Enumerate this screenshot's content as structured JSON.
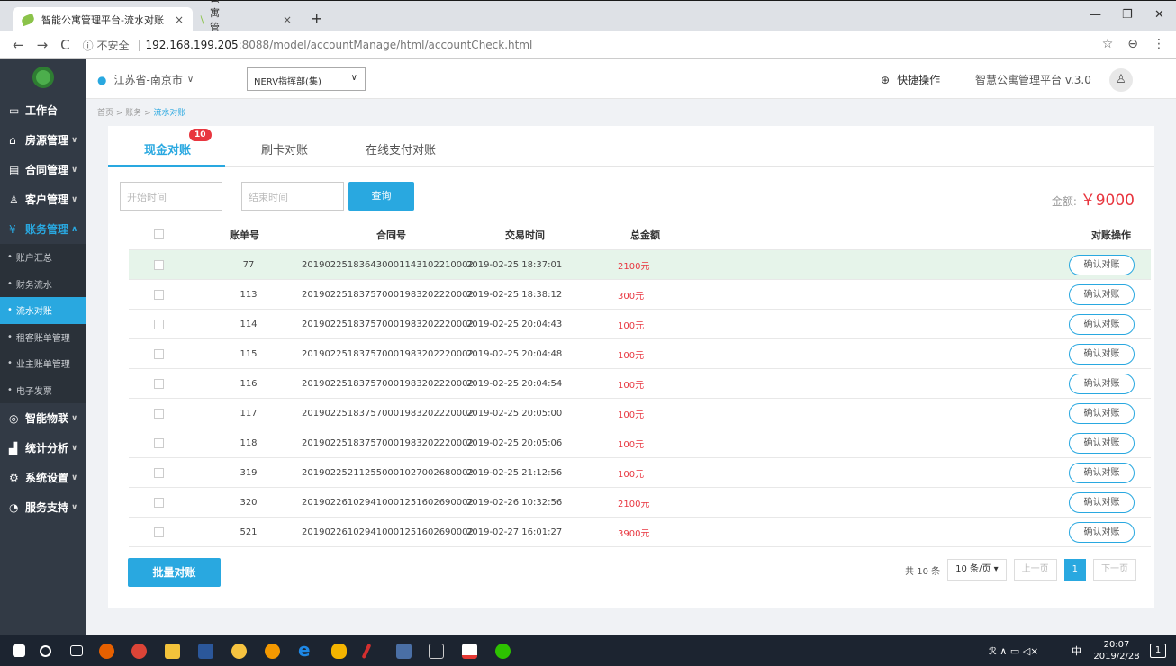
{
  "browser": {
    "tabs": [
      {
        "title": "智能公寓管理平台-流水对账",
        "close": "×"
      },
      {
        "title": "智能公寓管理平台",
        "close": "×"
      }
    ],
    "new_tab": "+",
    "url_security": "ⓘ 不安全",
    "url_host": "192.168.199.205",
    "url_path": ":8088/model/accountManage/html/accountCheck.html"
  },
  "sidebar": {
    "items": [
      {
        "label": "工作台",
        "icon": "monitor-icon"
      },
      {
        "label": "房源管理",
        "icon": "home-icon"
      },
      {
        "label": "合同管理",
        "icon": "document-icon"
      },
      {
        "label": "客户管理",
        "icon": "users-icon"
      },
      {
        "label": "账务管理",
        "icon": "yen-icon"
      }
    ],
    "sub_items": [
      "账户汇总",
      "财务流水",
      "流水对账",
      "租客账单管理",
      "业主账单管理",
      "电子发票"
    ],
    "more_items": [
      {
        "label": "智能物联",
        "icon": "iot-icon"
      },
      {
        "label": "统计分析",
        "icon": "chart-icon"
      },
      {
        "label": "系统设置",
        "icon": "gear-icon"
      },
      {
        "label": "服务支持",
        "icon": "support-icon"
      }
    ]
  },
  "topbar": {
    "location": "江苏省-南京市",
    "org": "NERV指挥部(集)",
    "quick_ops": "快捷操作",
    "platform": "智慧公寓管理平台 v.3.0"
  },
  "breadcrumb": {
    "path": "首页 > 账务 > ",
    "current": "流水对账"
  },
  "tabs": [
    {
      "label": "现金对账",
      "badge": "10"
    },
    {
      "label": "刷卡对账"
    },
    {
      "label": "在线支付对账"
    }
  ],
  "filters": {
    "start_placeholder": "开始时间",
    "end_placeholder": "结束时间",
    "query_label": "查询",
    "amount_label": "金额: ",
    "amount_value": "￥9000"
  },
  "table": {
    "headers": [
      "账单号",
      "合同号",
      "交易时间",
      "总金额",
      "对账操作"
    ],
    "confirm_label": "确认对账",
    "rows": [
      {
        "bill": "77",
        "contract": "20190225183643000114310221000​2",
        "time": "2019-02-25 18:37:01",
        "amount": "2100元"
      },
      {
        "bill": "113",
        "contract": "20190225183757000198320222000​2",
        "time": "2019-02-25 18:38:12",
        "amount": "300元"
      },
      {
        "bill": "114",
        "contract": "20190225183757000198320222000​2",
        "time": "2019-02-25 20:04:43",
        "amount": "100元"
      },
      {
        "bill": "115",
        "contract": "20190225183757000198320222000​2",
        "time": "2019-02-25 20:04:48",
        "amount": "100元"
      },
      {
        "bill": "116",
        "contract": "20190225183757000198320222000​2",
        "time": "2019-02-25 20:04:54",
        "amount": "100元"
      },
      {
        "bill": "117",
        "contract": "20190225183757000198320222000​2",
        "time": "2019-02-25 20:05:00",
        "amount": "100元"
      },
      {
        "bill": "118",
        "contract": "20190225183757000198320222000​2",
        "time": "2019-02-25 20:05:06",
        "amount": "100元"
      },
      {
        "bill": "319",
        "contract": "20190225211255000102700268000​2",
        "time": "2019-02-25 21:12:56",
        "amount": "100元"
      },
      {
        "bill": "320",
        "contract": "20190226102941000125160269000​2",
        "time": "2019-02-26 10:32:56",
        "amount": "2100元"
      },
      {
        "bill": "521",
        "contract": "20190226102941000125160269000​2",
        "time": "2019-02-27 16:01:27",
        "amount": "3900元"
      }
    ]
  },
  "footer": {
    "batch_label": "批量对账",
    "total": "共 10 条",
    "page_size": "10 条/页 ▾",
    "prev": "上一页",
    "page": "1",
    "next": "下一页"
  },
  "taskbar": {
    "time": "20:07",
    "date": "2019/2/28",
    "ime": "中",
    "notify": "1"
  },
  "colors": {
    "accent": "#29a8e0",
    "sidebar": "#323a45",
    "danger": "#e8363f"
  }
}
